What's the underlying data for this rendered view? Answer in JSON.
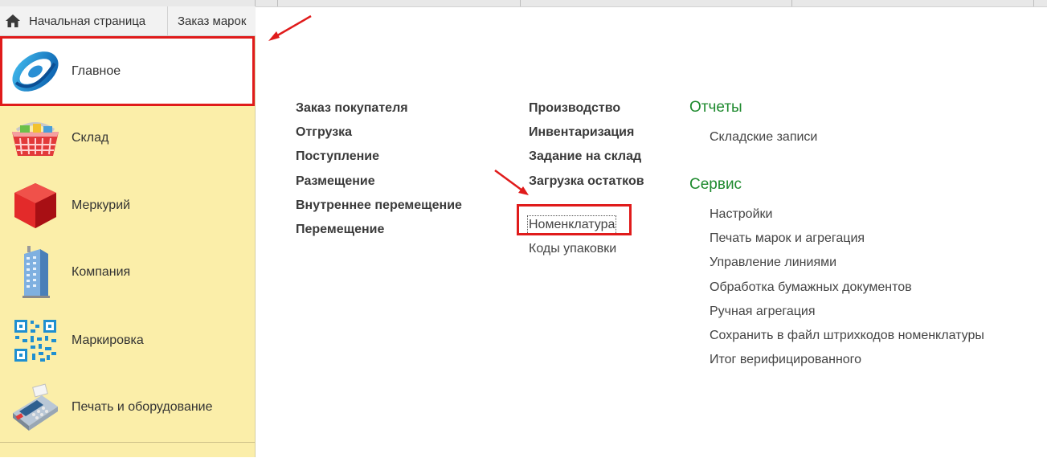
{
  "tabs": {
    "home": "Начальная страница",
    "orders": "Заказ марок"
  },
  "sidebar": {
    "items": [
      {
        "label": "Главное",
        "icon": "main-logo-icon",
        "active": true
      },
      {
        "label": "Склад",
        "icon": "basket-icon"
      },
      {
        "label": "Меркурий",
        "icon": "red-cube-icon"
      },
      {
        "label": "Компания",
        "icon": "building-icon"
      },
      {
        "label": "Маркировка",
        "icon": "qr-code-icon"
      },
      {
        "label": "Печать и оборудование",
        "icon": "payment-terminal-icon"
      }
    ]
  },
  "main": {
    "column1": [
      "Заказ покупателя",
      "Отгрузка",
      "Поступление",
      "Размещение",
      "Внутреннее перемещение",
      "Перемещение"
    ],
    "column2": [
      "Производство",
      "Инвентаризация",
      "Задание на склад",
      "Загрузка остатков"
    ],
    "column2_links": [
      "Номенклатура",
      "Коды упаковки"
    ],
    "reports": {
      "title": "Отчеты",
      "items": [
        "Складские записи"
      ]
    },
    "service": {
      "title": "Сервис",
      "items": [
        "Настройки",
        "Печать марок и агрегация",
        "Управление линиями",
        "Обработка бумажных документов",
        "Ручная агрегация",
        "Сохранить в файл штрихкодов номенклатуры",
        "Итог верифицированного"
      ]
    }
  },
  "colors": {
    "sidebar_bg": "#fbeea9",
    "section_title": "#1e8a2e",
    "highlight_border": "#e01b1b"
  }
}
